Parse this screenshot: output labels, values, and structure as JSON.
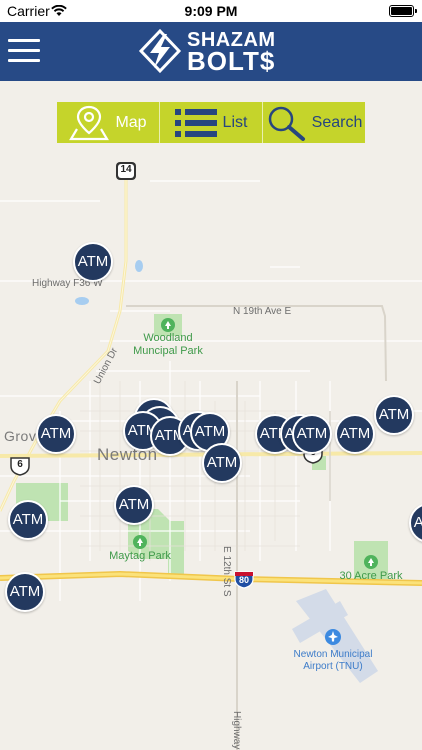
{
  "status_bar": {
    "carrier": "Carrier",
    "time": "9:09 PM"
  },
  "header": {
    "menu_icon": "hamburger-menu-icon",
    "logo": {
      "line1": "SHAZAM",
      "line2": "BOLT$"
    }
  },
  "view_switcher": {
    "tabs": [
      {
        "label": "Map",
        "icon": "map-pin-icon",
        "selected": true
      },
      {
        "label": "List",
        "icon": "list-icon",
        "selected": false
      },
      {
        "label": "Search",
        "icon": "magnifier-icon",
        "selected": false
      }
    ]
  },
  "map": {
    "labels": {
      "highway_f36": "Highway F36 W",
      "n19th": "N 19th Ave E",
      "union_dr": "Union Dr",
      "e12th": "E 12th St S",
      "highway_bottom": "Highway",
      "grove": "Grov",
      "town": "Newton"
    },
    "shields": {
      "us14": "14",
      "us6_left": "6",
      "us6_right": "6",
      "i80": "80"
    },
    "parks": {
      "woodland": "Woodland\nMuncipal Park",
      "maytag": "Maytag Park",
      "acre30": "30 Acre Park"
    },
    "airport": "Newton Municipal\nAirport (TNU)",
    "atm_label": "ATM",
    "colors": {
      "accent": "#c5d42b",
      "header": "#274a86",
      "marker": "#23395f",
      "park": "#bfe3b2"
    }
  }
}
